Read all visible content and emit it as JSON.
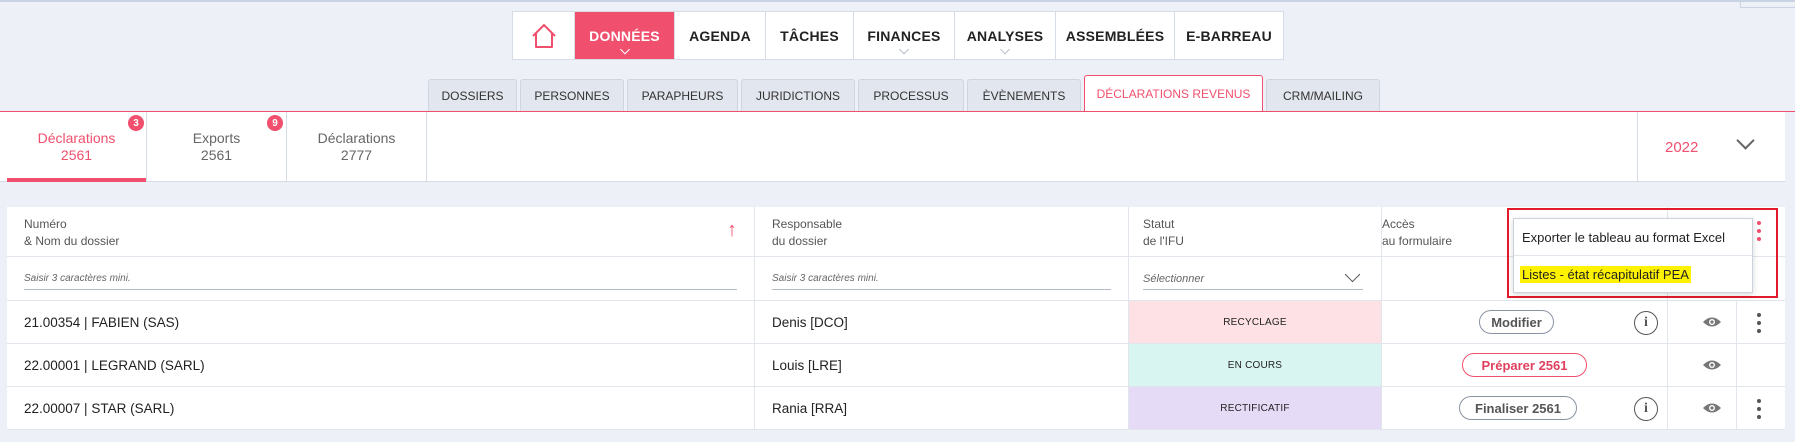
{
  "main_nav": {
    "home_icon": "home-icon",
    "items": [
      {
        "label": "DONNÉES",
        "active": true,
        "has_chevron": true
      },
      {
        "label": "AGENDA",
        "active": false,
        "has_chevron": false
      },
      {
        "label": "TÂCHES",
        "active": false,
        "has_chevron": false
      },
      {
        "label": "FINANCES",
        "active": false,
        "has_chevron": true
      },
      {
        "label": "ANALYSES",
        "active": false,
        "has_chevron": true
      },
      {
        "label": "ASSEMBLÉES",
        "active": false,
        "has_chevron": false
      },
      {
        "label": "E-BARREAU",
        "active": false,
        "has_chevron": false
      }
    ]
  },
  "sub_tabs": [
    {
      "label": "DOSSIERS",
      "active": false
    },
    {
      "label": "PERSONNES",
      "active": false
    },
    {
      "label": "PARAPHEURS",
      "active": false
    },
    {
      "label": "JURIDICTIONS",
      "active": false
    },
    {
      "label": "PROCESSUS",
      "active": false
    },
    {
      "label": "ÈVÈNEMENTS",
      "active": false
    },
    {
      "label": "DÉCLARATIONS REVENUS",
      "active": true
    },
    {
      "label": "CRM/MAILING",
      "active": false
    }
  ],
  "decl_tabs": [
    {
      "line1": "Déclarations",
      "line2": "2561",
      "badge": "3",
      "active": true
    },
    {
      "line1": "Exports",
      "line2": "2561",
      "badge": "9",
      "active": false
    },
    {
      "line1": "Déclarations",
      "line2": "2777",
      "badge": "",
      "active": false
    }
  ],
  "year": "2022",
  "table": {
    "headers": {
      "numero_l1": "Numéro",
      "numero_l2": "& Nom du dossier",
      "resp_l1": "Responsable",
      "resp_l2": "du dossier",
      "statut_l1": "Statut",
      "statut_l2": "de l'IFU",
      "acces_l1": "Accès",
      "acces_l2": "au formulaire"
    },
    "sort_icon": "arrow-up-icon",
    "filters": {
      "numero_placeholder": "Saisir 3 caractères mini.",
      "resp_placeholder": "Saisir 3 caractères mini.",
      "statut_placeholder": "Sélectionner"
    },
    "rows": [
      {
        "dossier": "21.00354 | FABIEN (SAS)",
        "responsable": "Denis [DCO]",
        "statut": "RECYCLAGE",
        "statut_color": "#fde1e4",
        "action": "Modifier",
        "action_style": "grey",
        "info": true,
        "kebab": true
      },
      {
        "dossier": "22.00001 | LEGRAND (SARL)",
        "responsable": "Louis [LRE]",
        "statut": "EN COURS",
        "statut_color": "#d8f5f1",
        "action": "Préparer 2561",
        "action_style": "red",
        "info": false,
        "kebab": false
      },
      {
        "dossier": "22.00007 | STAR (SARL)",
        "responsable": "Rania [RRA]",
        "statut": "RECTIFICATIF",
        "statut_color": "#e6dbf6",
        "action": "Finaliser 2561",
        "action_style": "grey",
        "info": true,
        "kebab": true
      }
    ]
  },
  "dropdown_menu": {
    "items": [
      {
        "label": "Exporter le tableau au format Excel",
        "highlighted": false
      },
      {
        "label": "Listes - état récapitulatif PEA",
        "highlighted": true
      }
    ],
    "highlight_color": "#fff200",
    "outline_color": "#e21b2c"
  },
  "colors": {
    "accent": "#f0506e"
  }
}
